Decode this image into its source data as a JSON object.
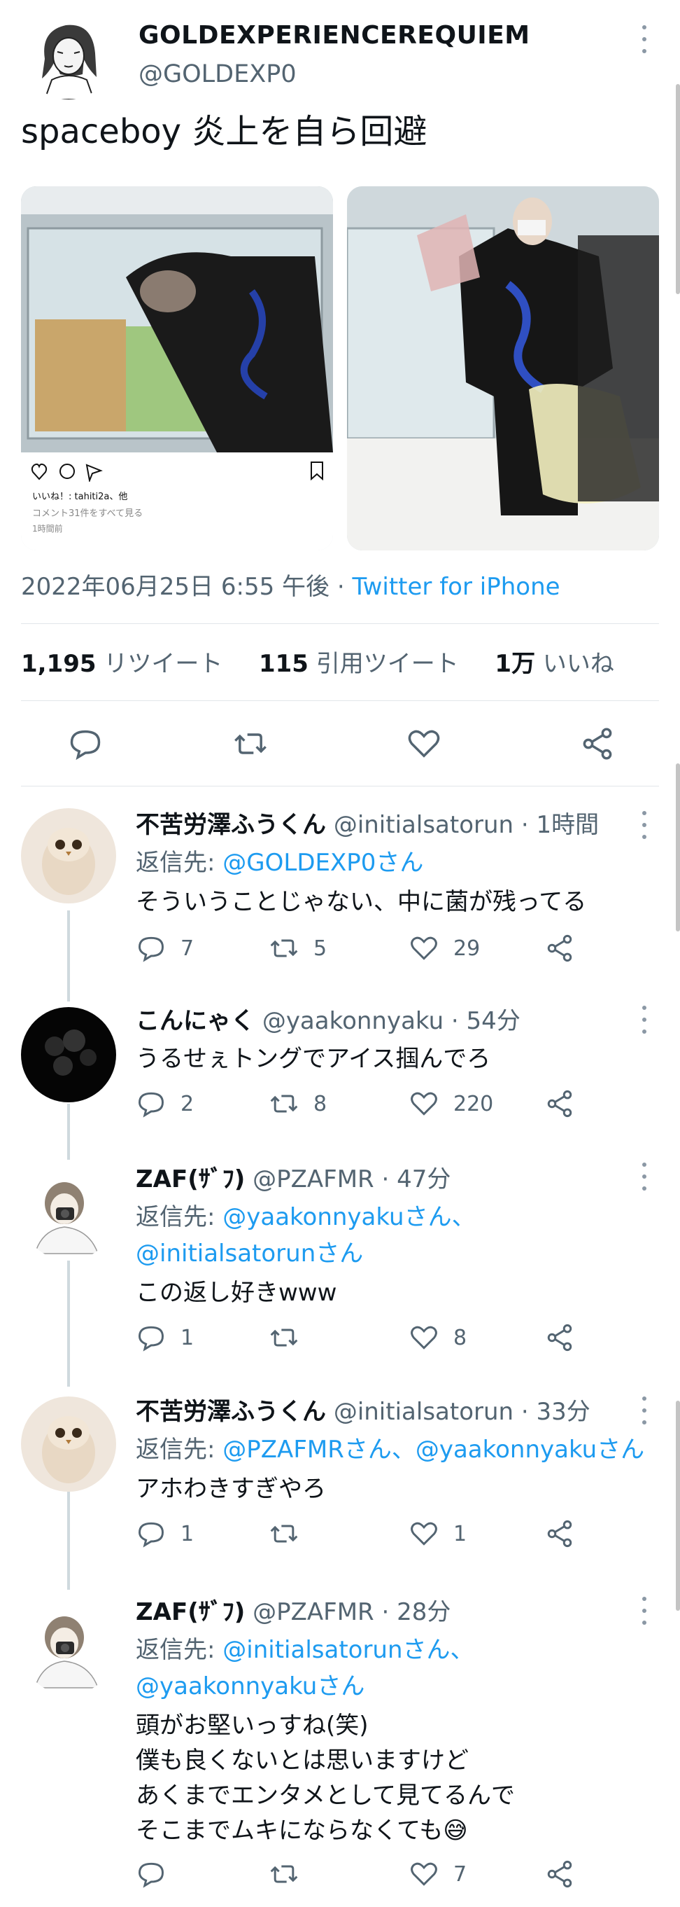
{
  "tweet": {
    "display_name": "GOLDEXPERIENCEREQUIEM",
    "handle": "@GOLDEXP0",
    "text": "spaceboy 炎上を自ら回避",
    "timestamp": "2022年06月25日 6:55 午後 · ",
    "client": "Twitter for iPhone",
    "photo1_caption": {
      "likes_line": "いいね！: tahiti2a、他",
      "comments_line": "コメント31件をすべて見る",
      "time_line": "1時間前"
    },
    "stats": {
      "retweets_count": "1,195",
      "retweets_label": "リツイート",
      "quotes_count": "115",
      "quotes_label": "引用ツイート",
      "likes_count": "1万",
      "likes_label": "いいね"
    }
  },
  "replies": [
    {
      "display_name": "不苦労澤ふうくん",
      "handle_time": "@initialsatorun · 1時間",
      "reply_to_prefix": "返信先: ",
      "reply_to_lines": [
        "@GOLDEXP0さん"
      ],
      "text_lines": [
        "そういうことじゃない、中に菌が残ってる"
      ],
      "replies": "7",
      "retweets": "5",
      "likes": "29"
    },
    {
      "display_name": "こんにゃく",
      "handle_time": "@yaakonnyaku · 54分",
      "reply_to_prefix": "",
      "reply_to_lines": [],
      "text_lines": [
        "うるせぇトングでアイス掴んでろ"
      ],
      "replies": "2",
      "retweets": "8",
      "likes": "220"
    },
    {
      "display_name": "ZAF(ｻﾞﾌ)",
      "handle_time": "@PZAFMR · 47分",
      "reply_to_prefix": "返信先: ",
      "reply_to_lines": [
        "@yaakonnyakuさん、",
        "@initialsatorunさん"
      ],
      "text_lines": [
        "この返し好きwww"
      ],
      "replies": "1",
      "retweets": "",
      "likes": "8"
    },
    {
      "display_name": "不苦労澤ふうくん",
      "handle_time": "@initialsatorun · 33分",
      "reply_to_prefix": "返信先: ",
      "reply_to_lines": [
        "@PZAFMRさん、@yaakonnyakuさん"
      ],
      "text_lines": [
        "アホわきすぎやろ"
      ],
      "replies": "1",
      "retweets": "",
      "likes": "1"
    },
    {
      "display_name": "ZAF(ｻﾞﾌ)",
      "handle_time": "@PZAFMR · 28分",
      "reply_to_prefix": "返信先: ",
      "reply_to_lines": [
        "@initialsatorunさん、",
        "@yaakonnyakuさん"
      ],
      "text_lines": [
        "頭がお堅いっすね(笑)",
        "僕も良くないとは思いますけど",
        "あくまでエンタメとして見てるんで",
        "そこまでムキにならなくても😅"
      ],
      "replies": "",
      "retweets": "",
      "likes": "7"
    }
  ],
  "colors": {
    "text": "#0f1419",
    "secondary": "#536471",
    "link": "#1d9bf0",
    "divider": "#e1e6ea"
  }
}
